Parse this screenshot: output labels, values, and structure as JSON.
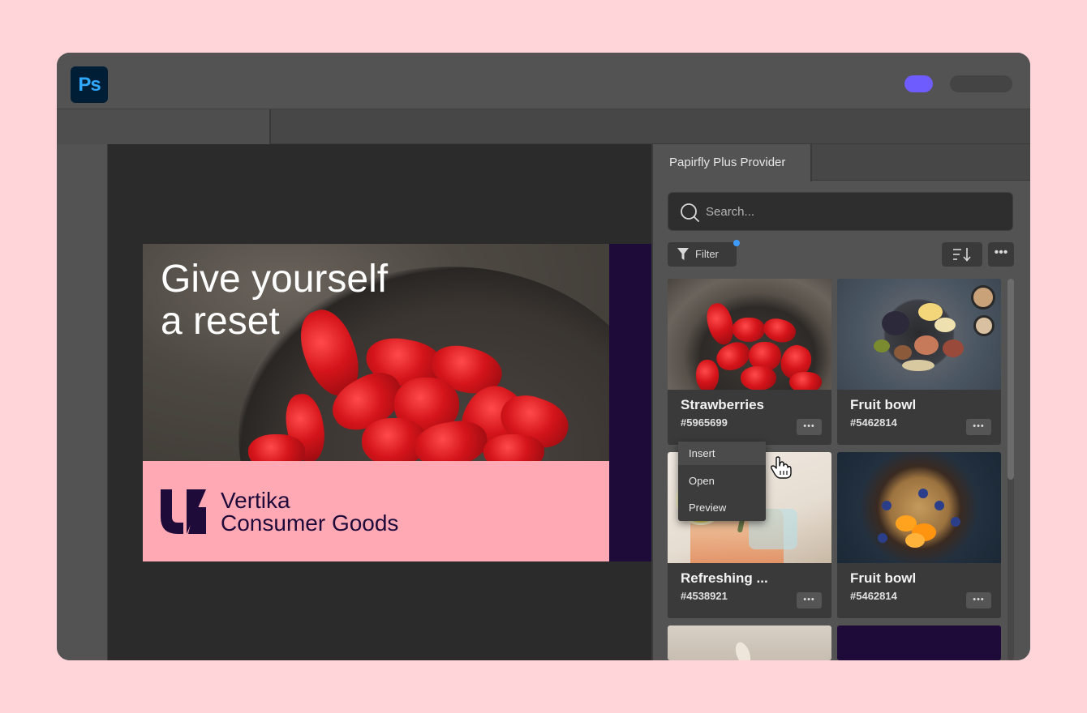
{
  "app": {
    "logo_text": "Ps",
    "accent_color": "#6e5cff"
  },
  "artwork": {
    "headline_line1": "Give yourself",
    "headline_line2": "a reset",
    "brand_line1": "Vertika",
    "brand_line2": "Consumer Goods",
    "band_color": "#ffa9b5",
    "brand_color": "#1e0b3a"
  },
  "panel": {
    "tab_label": "Papirfly Plus Provider",
    "search": {
      "placeholder": "Search...",
      "value": ""
    },
    "filter_label": "Filter",
    "filter_indicator_color": "#3e9bff",
    "more_label": "•••"
  },
  "assets": [
    {
      "title": "Strawberries",
      "id": "#5965699",
      "more": "•••",
      "image": "strawberries"
    },
    {
      "title": "Fruit bowl",
      "id": "#5462814",
      "more": "•••",
      "image": "fruit-platter"
    },
    {
      "title": "Refreshing ...",
      "id": "#4538921",
      "more": "•••",
      "image": "cocktail"
    },
    {
      "title": "Fruit bowl",
      "id": "#5462814",
      "more": "•••",
      "image": "pancake-skillet"
    }
  ],
  "context_menu": {
    "items": [
      "Insert",
      "Open",
      "Preview"
    ],
    "hovered": "Insert"
  }
}
